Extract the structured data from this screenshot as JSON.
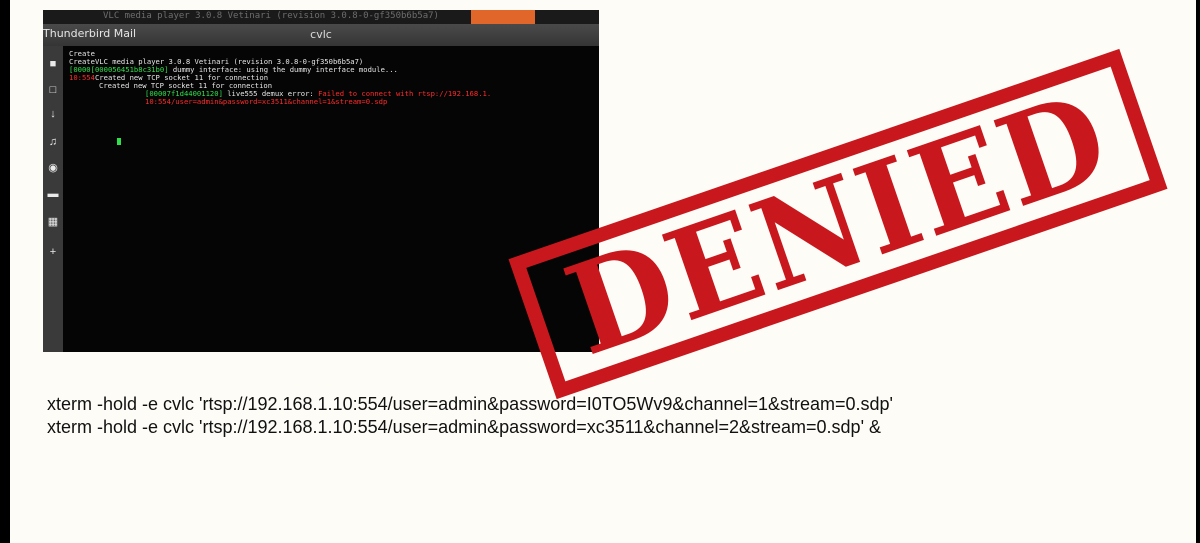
{
  "screenshot": {
    "ghost_title": "VLC media player 3.0.8 Vetinari (revision 3.0.8-0-gf350b6b5a7)",
    "app_name": "Thunderbird Mail",
    "window_title": "cvlc",
    "launcher_icons": [
      "files-icon",
      "document-icon",
      "download-icon",
      "music-icon",
      "camera-icon",
      "window-icon",
      "calendar-icon",
      "add-icon"
    ],
    "terminal_lines": [
      {
        "prefix": "Create",
        "prefix_color": "white",
        "text": ""
      },
      {
        "prefix": "Create",
        "prefix_color": "white",
        "text": "VLC media player 3.0.8 Vetinari (revision 3.0.8-0-gf350b6b5a7)"
      },
      {
        "prefix": "[0000",
        "prefix_color": "green",
        "text_green": "[000056451b8c31b0]",
        "text": " dummy interface: using the dummy interface module..."
      },
      {
        "prefix": "10:554",
        "prefix_color": "red",
        "text": "Created new TCP socket 11 for connection"
      },
      {
        "prefix": "",
        "prefix_color": "white",
        "text": "Created new TCP socket 11 for connection"
      },
      {
        "prefix": "",
        "prefix_color": "white",
        "text_green": "[00007f1d44001120]",
        "text": " live555 demux error: ",
        "text_red": "Failed to connect with rtsp://192.168.1."
      },
      {
        "prefix": "",
        "prefix_color": "white",
        "text_red": "10:554/user=admin&password=xc3511&channel=1&stream=0.sdp",
        "text": ""
      }
    ]
  },
  "stamp": {
    "label": "DENIED",
    "color": "#c8181d"
  },
  "commands": [
    "xterm -hold -e cvlc 'rtsp://192.168.1.10:554/user=admin&password=I0TO5Wv9&channel=1&stream=0.sdp'",
    "xterm -hold -e cvlc 'rtsp://192.168.1.10:554/user=admin&password=xc3511&channel=2&stream=0.sdp' &"
  ]
}
